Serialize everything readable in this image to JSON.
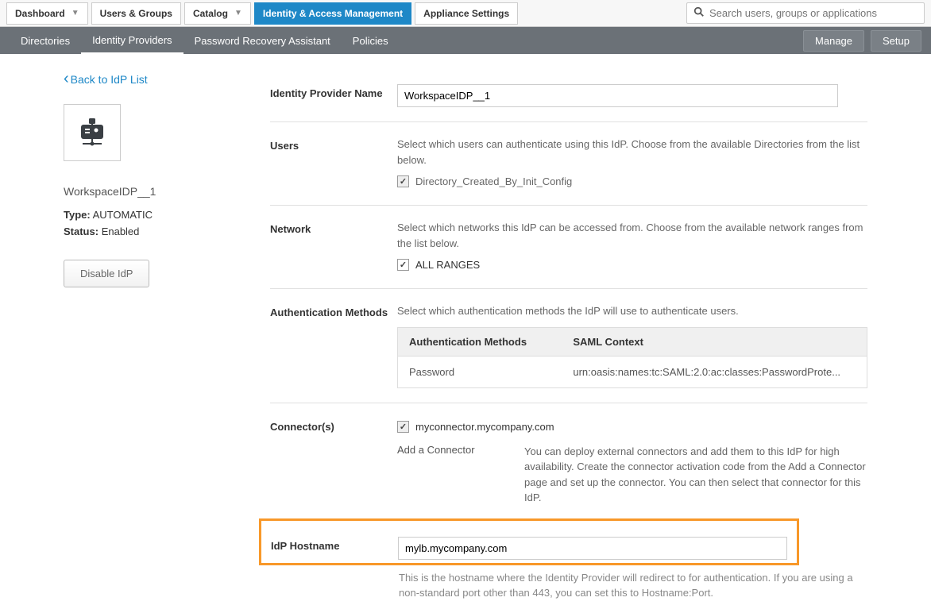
{
  "topTabs": {
    "dashboard": "Dashboard",
    "users": "Users & Groups",
    "catalog": "Catalog",
    "iam": "Identity & Access Management",
    "appliance": "Appliance Settings"
  },
  "search": {
    "placeholder": "Search users, groups or applications"
  },
  "subTabs": {
    "directories": "Directories",
    "idp": "Identity Providers",
    "pra": "Password Recovery Assistant",
    "policies": "Policies"
  },
  "subActions": {
    "manage": "Manage",
    "setup": "Setup"
  },
  "left": {
    "back": "Back to IdP List",
    "name": "WorkspaceIDP__1",
    "typeLabel": "Type:",
    "typeValue": "AUTOMATIC",
    "statusLabel": "Status:",
    "statusValue": "Enabled",
    "disable": "Disable IdP"
  },
  "form": {
    "nameLabel": "Identity Provider Name",
    "nameValue": "WorkspaceIDP__1",
    "usersLabel": "Users",
    "usersHelp": "Select which users can authenticate using this IdP. Choose from the available Directories from the list below.",
    "usersCheck": "Directory_Created_By_Init_Config",
    "networkLabel": "Network",
    "networkHelp": "Select which networks this IdP can be accessed from. Choose from the available network ranges from the list below.",
    "networkCheck": "ALL RANGES",
    "authLabel": "Authentication Methods",
    "authHelp": "Select which authentication methods the IdP will use to authenticate users.",
    "authTable": {
      "h1": "Authentication Methods",
      "h2": "SAML Context",
      "r1c1": "Password",
      "r1c2": "urn:oasis:names:tc:SAML:2.0:ac:classes:PasswordProte..."
    },
    "connLabel": "Connector(s)",
    "connCheck": "myconnector.mycompany.com",
    "connAdd": "Add a Connector",
    "connHelp": "You can deploy external connectors and add them to this IdP for high availability. Create the connector activation code from the Add a Connector page and set up the connector. You can then select that connector for this IdP.",
    "hostLabel": "IdP Hostname",
    "hostValue": "mylb.mycompany.com",
    "hostHelp": "This is the hostname where the Identity Provider will redirect to for authentication. If you are using a non-standard port other than 443, you can set this to Hostname:Port."
  }
}
